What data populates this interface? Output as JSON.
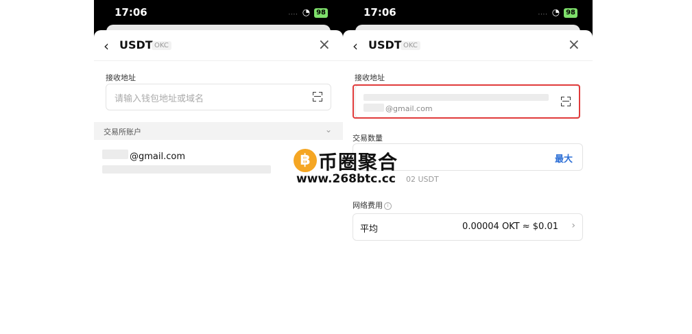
{
  "status": {
    "time": "17:06",
    "signal": "....",
    "battery": "98"
  },
  "left": {
    "title": "USDT",
    "chain": "OKC",
    "address_label": "接收地址",
    "address_placeholder": "请输入钱包地址或域名",
    "section_label": "交易所账户",
    "account_email": "@gmail.com"
  },
  "right": {
    "title": "USDT",
    "chain": "OKC",
    "address_label": "接收地址",
    "address_email_hint": "@gmail.com",
    "amount_label": "交易数量",
    "max_label": "最大",
    "balance_fragment": "02 USDT",
    "fee_label": "网络费用",
    "fee_speed": "平均",
    "fee_value": "0.00004 OKT ≈ $0.01"
  },
  "icons": {
    "back": "chevron-left-icon",
    "close": "close-icon",
    "scan": "scan-icon",
    "chevron": "chevron-down-icon",
    "info": "info-icon",
    "arrow": "chevron-right-icon"
  },
  "watermark": {
    "brand": "币圈聚合",
    "url": "www.268btc.cc"
  },
  "colors": {
    "highlight": "#e03a3a",
    "link": "#2d6fd6",
    "watermark_coin": "#f5a623"
  }
}
